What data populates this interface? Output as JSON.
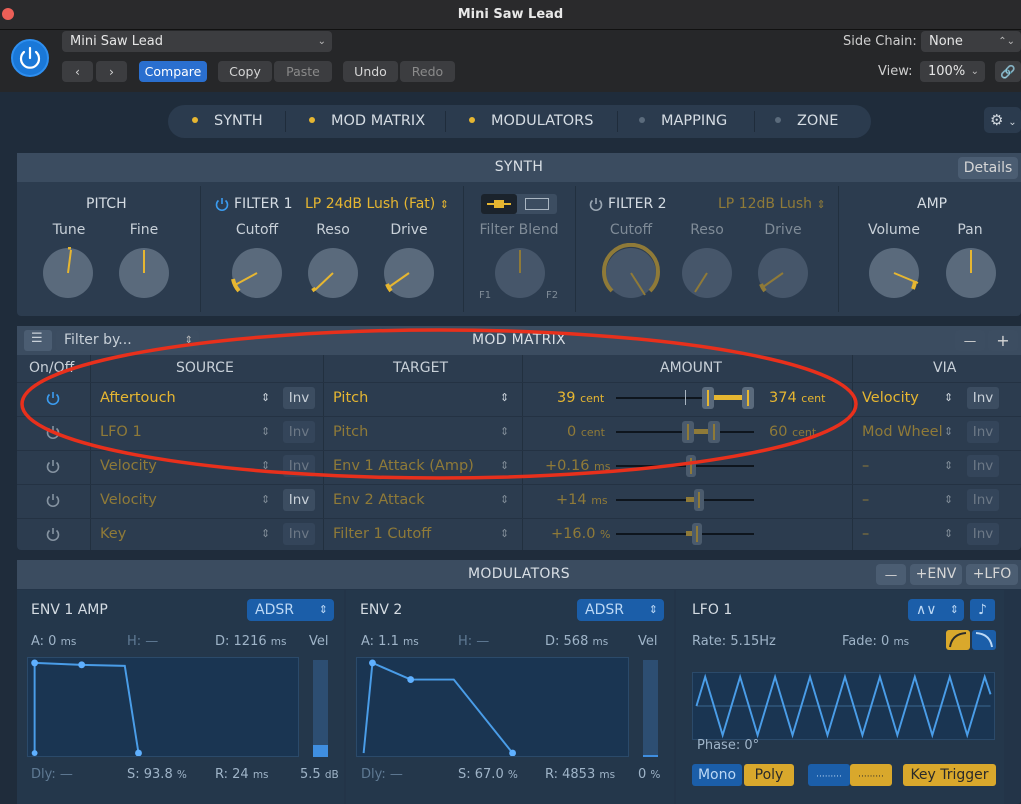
{
  "window": {
    "title": "Mini Saw Lead"
  },
  "header": {
    "preset": "Mini Saw Lead",
    "compare_label": "Compare",
    "copy_label": "Copy",
    "paste_label": "Paste",
    "undo_label": "Undo",
    "redo_label": "Redo",
    "side_chain_label": "Side Chain:",
    "side_chain_value": "None",
    "view_label": "View:",
    "view_value": "100%"
  },
  "tabs": [
    {
      "label": "SYNTH",
      "dot_color": "#e6b631"
    },
    {
      "label": "MOD MATRIX",
      "dot_color": "#e6b631"
    },
    {
      "label": "MODULATORS",
      "dot_color": "#e6b631"
    },
    {
      "label": "MAPPING",
      "dot_color": "#5b6b7c"
    },
    {
      "label": "ZONE",
      "dot_color": "#5b6b7c"
    }
  ],
  "synth": {
    "header": "SYNTH",
    "details_label": "Details",
    "pitch": {
      "title": "PITCH",
      "tune": "Tune",
      "fine": "Fine"
    },
    "filter1": {
      "title": "FILTER 1",
      "type": "LP 24dB Lush (Fat)",
      "cutoff": "Cutoff",
      "reso": "Reso",
      "drive": "Drive"
    },
    "blend": {
      "title": "Filter Blend",
      "f1": "F1",
      "f2": "F2"
    },
    "filter2": {
      "title": "FILTER 2",
      "type": "LP 12dB Lush",
      "cutoff": "Cutoff",
      "reso": "Reso",
      "drive": "Drive"
    },
    "amp": {
      "title": "AMP",
      "volume": "Volume",
      "pan": "Pan"
    }
  },
  "mod_matrix": {
    "filter_placeholder": "Filter by...",
    "header": "MOD MATRIX",
    "minus": "—",
    "plus": "+",
    "columns": {
      "onoff": "On/Off",
      "source": "SOURCE",
      "target": "TARGET",
      "amount": "AMOUNT",
      "via": "VIA"
    },
    "rows": [
      {
        "source": "Aftertouch",
        "inv": "Inv",
        "target": "Pitch",
        "amount_left": "39",
        "amount_left_unit": "cent",
        "amount_right": "374",
        "amount_right_unit": "cent",
        "via": "Velocity",
        "via_inv": "Inv",
        "active": true
      },
      {
        "source": "LFO 1",
        "inv": "Inv",
        "target": "Pitch",
        "amount_left": "0",
        "amount_left_unit": "cent",
        "amount_right": "60",
        "amount_right_unit": "cent",
        "via": "Mod Wheel",
        "via_inv": "Inv",
        "active": false
      },
      {
        "source": "Velocity",
        "inv": "Inv",
        "target": "Env 1 Attack (Amp)",
        "amount_left": "+0.16",
        "amount_left_unit": "ms",
        "amount_right": "",
        "amount_right_unit": "",
        "via": "–",
        "via_inv": "Inv",
        "active": false
      },
      {
        "source": "Velocity",
        "inv": "Inv",
        "target": "Env 2 Attack",
        "amount_left": "+14",
        "amount_left_unit": "ms",
        "amount_right": "",
        "amount_right_unit": "",
        "via": "–",
        "via_inv": "Inv",
        "active": false
      },
      {
        "source": "Key",
        "inv": "Inv",
        "target": "Filter 1 Cutoff",
        "amount_left": "+16.0",
        "amount_left_unit": "%",
        "amount_right": "",
        "amount_right_unit": "",
        "via": "–",
        "via_inv": "Inv",
        "active": false
      }
    ]
  },
  "modulators": {
    "header": "MODULATORS",
    "minus": "—",
    "add_env": "+ENV",
    "add_lfo": "+LFO",
    "env1": {
      "title": "ENV 1 AMP",
      "mode": "ADSR",
      "a": "A: 0",
      "a_u": "ms",
      "h": "H: —",
      "d": "D: 1216",
      "d_u": "ms",
      "vel": "Vel",
      "dly": "Dly: —",
      "s": "S: 93.8",
      "s_u": "%",
      "r": "R: 24",
      "r_u": "ms",
      "vel_val": "5.5",
      "vel_u": "dB"
    },
    "env2": {
      "title": "ENV 2",
      "mode": "ADSR",
      "a": "A: 1.1",
      "a_u": "ms",
      "h": "H: —",
      "d": "D: 568",
      "d_u": "ms",
      "vel": "Vel",
      "dly": "Dly: —",
      "s": "S: 67.0",
      "s_u": "%",
      "r": "R: 4853",
      "r_u": "ms",
      "vel_val": "0",
      "vel_u": "%"
    },
    "lfo1": {
      "title": "LFO 1",
      "rate": "Rate: 5.15Hz",
      "fade": "Fade: 0",
      "fade_u": "ms",
      "phase": "Phase: 0°",
      "mono": "Mono",
      "poly": "Poly",
      "key_trigger": "Key Trigger"
    }
  }
}
